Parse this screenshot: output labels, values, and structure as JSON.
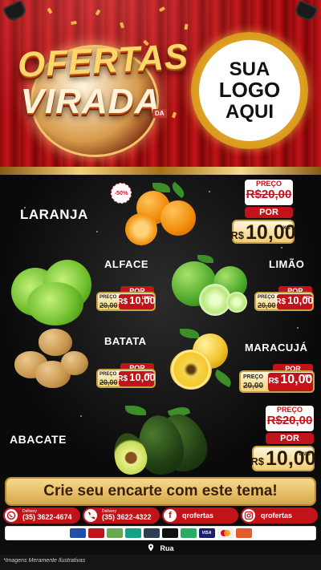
{
  "header": {
    "badge_line_1": "OFERTAS",
    "badge_line_2": "VIRADA",
    "badge_small": "DA",
    "logo_line_1": "SUA",
    "logo_line_2": "LOGO",
    "logo_line_3": "AQUI"
  },
  "products": {
    "laranja": {
      "name": "LARANJA",
      "discount": "-50%",
      "preco_label": "PREÇO",
      "old_price": "R$20,00",
      "por_label": "POR",
      "currency": "R$",
      "price": "10,00",
      "unit": "KG"
    },
    "alface": {
      "name": "ALFACE",
      "preco_label": "PREÇO",
      "old_price": "20,00",
      "por_label": "POR",
      "currency": "R$",
      "price": "10,00",
      "unit": "UNID"
    },
    "limao": {
      "name": "LIMÃO",
      "preco_label": "PREÇO",
      "old_price": "20,00",
      "por_label": "POR",
      "currency": "R$",
      "price": "10,00",
      "unit": "KG"
    },
    "batata": {
      "name": "BATATA",
      "preco_label": "PREÇO",
      "old_price": "20,00",
      "por_label": "POR",
      "currency": "R$",
      "price": "10,00",
      "unit": "KG"
    },
    "maracuja": {
      "name": "MARACUJÁ",
      "preco_label": "PREÇO",
      "old_price": "20,00",
      "por_label": "POR",
      "currency": "R$",
      "price": "10,00",
      "unit": "KG"
    },
    "abacate": {
      "name": "ABACATE",
      "preco_label": "PREÇO",
      "old_price": "R$20,00",
      "por_label": "POR",
      "currency": "R$",
      "price": "10,00",
      "unit": "UNID"
    }
  },
  "cta": {
    "text": "Crie seu encarte com este tema!"
  },
  "contacts": {
    "whatsapp": {
      "label": "Delivery",
      "number": "(35) 3622-4674",
      "icon": "whatsapp-icon"
    },
    "phone": {
      "label": "Delivery",
      "number": "(35) 3622-4322",
      "icon": "phone-icon"
    },
    "facebook": {
      "handle": "qrofertas",
      "icon": "facebook-icon"
    },
    "instagram": {
      "handle": "qrofertas",
      "icon": "instagram-icon"
    }
  },
  "payments": [
    "",
    "",
    "",
    "",
    "",
    "",
    "",
    "VISA",
    "",
    ""
  ],
  "address": {
    "text": "Rua",
    "icon": "map-pin-icon"
  },
  "disclaimer": "*Imagens Meramente Ilustrativas",
  "colors": {
    "curtain_red": "#c2141a",
    "gold": "#f4d17a",
    "price_red": "#c2121a",
    "background": "#0d0d0d"
  }
}
